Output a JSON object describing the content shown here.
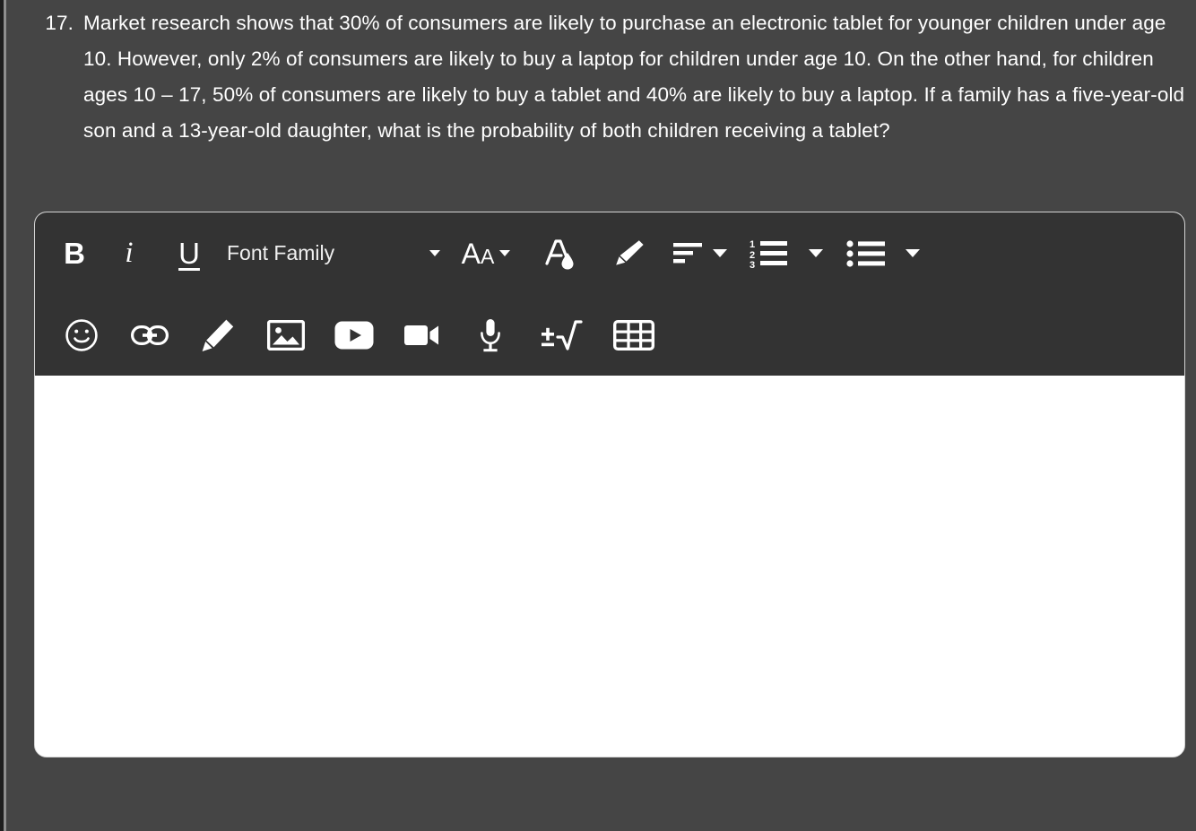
{
  "question": {
    "number": "17.",
    "text": "Market research shows that 30% of consumers are likely to purchase an electronic tablet for younger children under age 10. However, only 2% of consumers are likely to buy a laptop for children under age 10. On the other hand, for children ages 10 – 17, 50% of consumers are likely to buy a tablet and 40% are likely to buy a laptop. If a family has a five-year-old son and a 13-year-old daughter, what is the probability of both children receiving a tablet?"
  },
  "editor": {
    "toolbar": {
      "row1": [
        {
          "name": "bold-button",
          "icon": "bold-icon",
          "label": "B"
        },
        {
          "name": "italic-button",
          "icon": "italic-icon",
          "label": "i"
        },
        {
          "name": "underline-button",
          "icon": "underline-icon",
          "label": "U"
        },
        {
          "name": "font-family-select",
          "icon": "chevron-down-icon",
          "label": "Font Family"
        },
        {
          "name": "font-size-button",
          "icon": "font-size-icon",
          "label": "AA"
        },
        {
          "name": "text-color-button",
          "icon": "text-color-icon",
          "label": ""
        },
        {
          "name": "highlighter-button",
          "icon": "highlighter-icon",
          "label": ""
        },
        {
          "name": "align-button",
          "icon": "align-left-icon",
          "label": ""
        },
        {
          "name": "numbered-list-button",
          "icon": "numbered-list-icon",
          "label": ""
        },
        {
          "name": "bulleted-list-button",
          "icon": "bulleted-list-icon",
          "label": ""
        }
      ],
      "row2": [
        {
          "name": "emoji-button",
          "icon": "smiley-icon",
          "label": ""
        },
        {
          "name": "link-button",
          "icon": "link-icon",
          "label": ""
        },
        {
          "name": "draw-button",
          "icon": "pencil-icon",
          "label": ""
        },
        {
          "name": "image-button",
          "icon": "image-icon",
          "label": ""
        },
        {
          "name": "video-embed-button",
          "icon": "play-button-icon",
          "label": ""
        },
        {
          "name": "record-video-button",
          "icon": "video-camera-icon",
          "label": ""
        },
        {
          "name": "record-audio-button",
          "icon": "microphone-icon",
          "label": ""
        },
        {
          "name": "equation-button",
          "icon": "math-equation-icon",
          "label": "±√"
        },
        {
          "name": "table-button",
          "icon": "table-icon",
          "label": ""
        }
      ],
      "font_family_label": "Font Family",
      "font_size_label_big": "A",
      "font_size_label_small": "A",
      "bold_label": "B",
      "italic_label": "i",
      "underline_label": "U"
    },
    "content": {
      "value": "",
      "placeholder": ""
    }
  },
  "colors": {
    "page_background": "#454545",
    "toolbar_background": "#333333",
    "content_background": "#ffffff",
    "text": "#ffffff",
    "border": "#d4d4d4"
  }
}
